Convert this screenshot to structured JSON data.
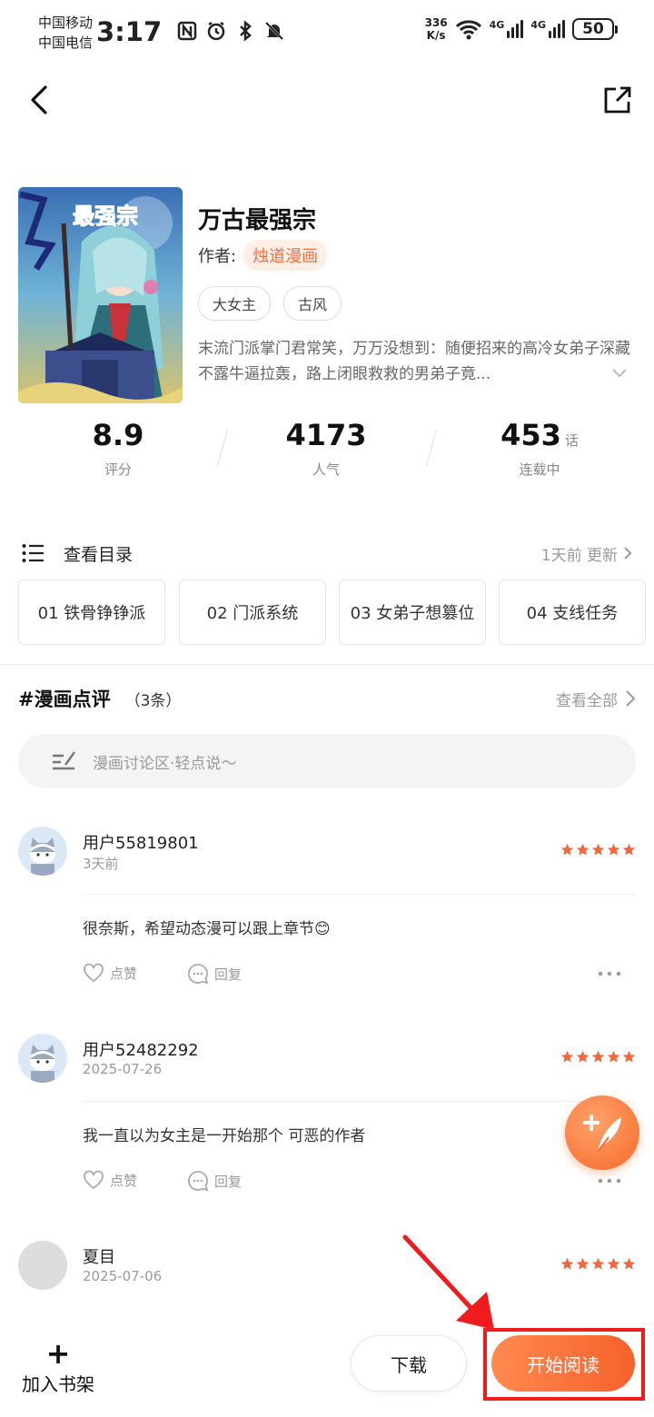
{
  "status_bar": {
    "carrier1": "中国移动",
    "carrier2": "中国电信",
    "time": "3:17",
    "net_speed_value": "336",
    "net_speed_unit": "K/s",
    "sig1_label": "4G",
    "sig2_label": "4G",
    "battery": "50"
  },
  "comic": {
    "title": "万古最强宗",
    "author_label": "作者:",
    "author": "烛道漫画",
    "tags": [
      "大女主",
      "古风"
    ],
    "synopsis": "末流门派掌门君常笑，万万没想到：随便招来的高冷女弟子深藏不露牛逼拉轰，路上闭眼救救的男弟子竟..."
  },
  "stats": {
    "rating": "8.9",
    "rating_label": "评分",
    "popularity": "4173",
    "popularity_label": "人气",
    "chapters": "453",
    "chapters_unit": "话",
    "chapters_label": "连载中"
  },
  "toc": {
    "label": "查看目录",
    "update": "1天前 更新",
    "chapters": [
      "01 铁骨铮铮派",
      "02 门派系统",
      "03 女弟子想篡位",
      "04 支线任务"
    ]
  },
  "reviews": {
    "title": "#漫画点评",
    "count": "（3条）",
    "view_all": "查看全部",
    "input_placeholder": "漫画讨论区·轻点说～",
    "like_label": "点赞",
    "reply_label": "回复",
    "items": [
      {
        "user": "用户55819801",
        "date": "3天前",
        "text": "很奈斯，希望动态漫可以跟上章节😊",
        "stars": 5
      },
      {
        "user": "用户52482292",
        "date": "2025-07-26",
        "text": "我一直以为女主是一开始那个 可恶的作者",
        "stars": 5
      },
      {
        "user": "夏目",
        "date": "2025-07-06",
        "text": "",
        "stars": 5
      }
    ]
  },
  "bottom": {
    "shelf_plus": "+",
    "shelf_label": "加入书架",
    "download_label": "下载",
    "read_label": "开始阅读"
  },
  "colors": {
    "accent": "#f6692a",
    "star": "#f2683a",
    "highlight": "#ee1c1c"
  }
}
